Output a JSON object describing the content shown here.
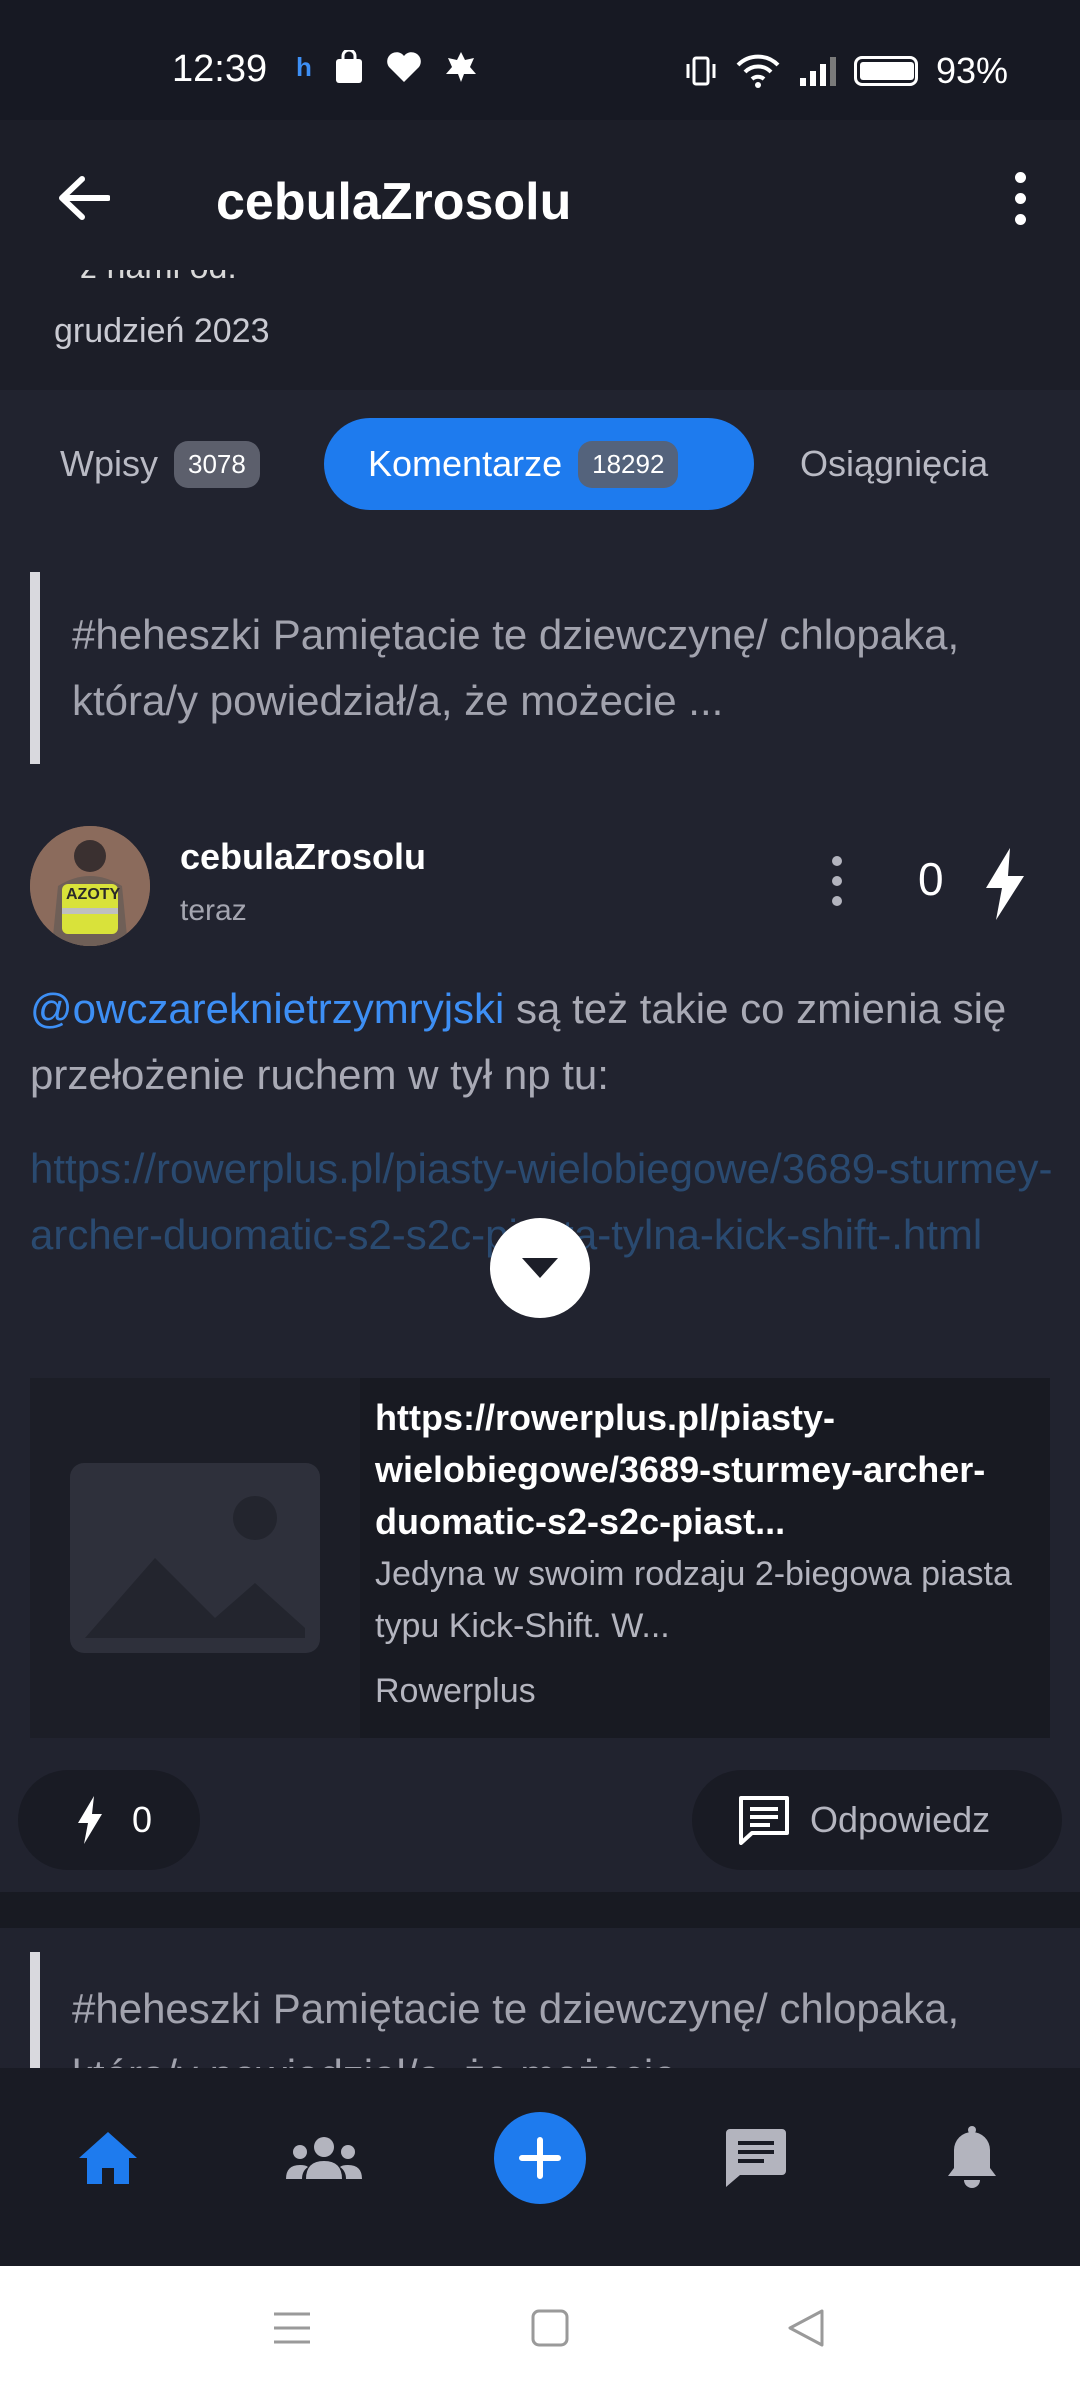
{
  "status_bar": {
    "time": "12:39",
    "battery": "93%",
    "battery_level": 0.93,
    "icons_left": [
      "h-icon",
      "shopping-bag-icon",
      "heart-icon",
      "leaf-icon"
    ],
    "icons_right": [
      "vibrate-icon",
      "wifi-icon",
      "signal-icon",
      "battery-icon"
    ]
  },
  "appbar": {
    "title": "cebulaZrosolu"
  },
  "profile": {
    "partial_text": "z nami od:",
    "joined": "grudzień 2023"
  },
  "tabs": [
    {
      "label": "Wpisy",
      "count": "3078"
    },
    {
      "label": "Komentarze",
      "count": "18292",
      "active": true
    },
    {
      "label": "Osiągnięcia"
    }
  ],
  "entry": {
    "quote": "#heheszki  Pamiętacie te dziewczynę/ chlopaka, która/y powiedział/a, że możecie ..."
  },
  "comment": {
    "author": "cebulaZrosolu",
    "time": "teraz",
    "score": "0",
    "mention": "@owczareknietrzymryjski",
    "text": " są też takie co zmienia się przełożenie ruchem w tył np tu:",
    "link": "https://rowerplus.pl/piasty-wielobiegowe/3689-sturmey-archer-duomatic-s2-s2c-piasta-tylna-kick-shift-.html",
    "avatar_label": "AZOTY"
  },
  "preview": {
    "title": "https://rowerplus.pl/piasty-wielobiegowe/3689-sturmey-archer-duomatic-s2-s2c-piast...",
    "description": "Jedyna w swoim rodzaju 2-biegowa piasta typu Kick-Shift. W...",
    "source": "Rowerplus"
  },
  "actions": {
    "vote_count": "0",
    "reply_label": "Odpowiedz"
  },
  "next_entry": {
    "quote": "#heheszki  Pamiętacie te dziewczynę/ chlopaka, która/y powiedział/a, że możecie"
  },
  "colors": {
    "accent": "#1e7bee",
    "background": "#21232f",
    "mention": "#3d8ff5"
  }
}
